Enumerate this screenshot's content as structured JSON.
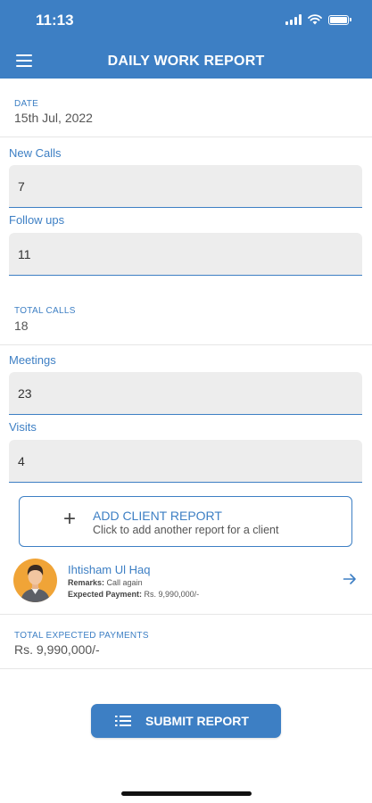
{
  "status": {
    "time": "11:13"
  },
  "appbar": {
    "title": "DAILY WORK REPORT",
    "menu_icon": "hamburger-menu-icon"
  },
  "date": {
    "caption": "DATE",
    "value": "15th Jul, 2022"
  },
  "fields": {
    "new_calls": {
      "label": "New Calls",
      "value": "7"
    },
    "follow_ups": {
      "label": "Follow ups",
      "value": "11"
    },
    "meetings": {
      "label": "Meetings",
      "value": "23"
    },
    "visits": {
      "label": "Visits",
      "value": "4"
    }
  },
  "total_calls": {
    "caption": "TOTAL CALLS",
    "value": "18"
  },
  "add_client": {
    "icon": "plus-icon",
    "title": "ADD CLIENT REPORT",
    "subtitle": "Click to add another report for a client"
  },
  "client": {
    "name": "Ihtisham Ul Haq",
    "remarks_label": "Remarks:",
    "remarks_value": "Call again",
    "payment_label": "Expected Payment:",
    "payment_value": "Rs. 9,990,000/-",
    "arrow_icon": "arrow-right-icon"
  },
  "total_payments": {
    "caption": "TOTAL EXPECTED PAYMENTS",
    "value": "Rs. 9,990,000/-"
  },
  "submit": {
    "label": "SUBMIT REPORT",
    "icon": "list-icon"
  },
  "colors": {
    "accent": "#3d7fc4",
    "field_bg": "#ededed",
    "avatar_bg": "#f0a437"
  }
}
